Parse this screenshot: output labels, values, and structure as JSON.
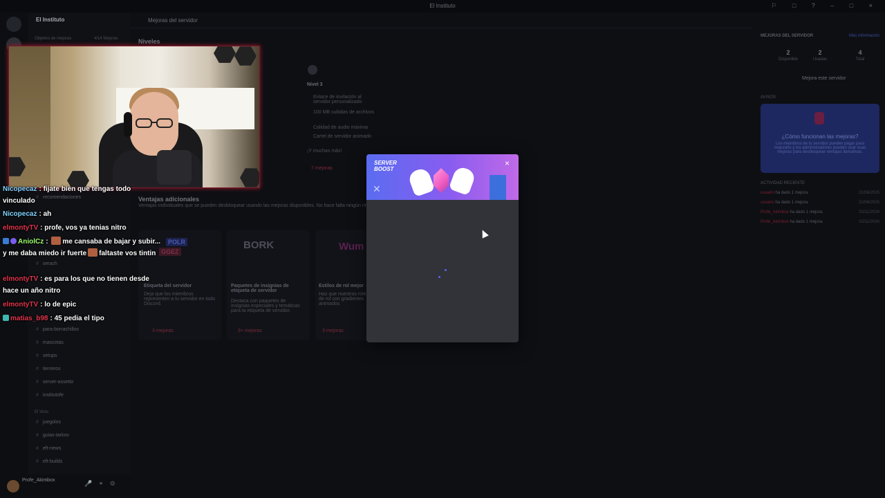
{
  "window": {
    "title": "El Instituto"
  },
  "sidebar": {
    "server_name": "El Instituto",
    "boost_goal": "Objetivo de mejoras",
    "boost_progress": "4/14 Mejoras",
    "channels": [
      "recomendaciones",
      "serach",
      "para-borrachillos",
      "mascotas",
      "setups",
      "tierreros",
      "server-assetto",
      "institutofe"
    ],
    "category": "El Vicio",
    "game_channels": [
      "juegolos",
      "guias-tarkov",
      "eft-news",
      "eft-builds"
    ],
    "user": {
      "name": "Profe_Akimbox"
    }
  },
  "main": {
    "header_title": "Mejoras del servidor",
    "levels_heading": "Niveles",
    "level3": {
      "title": "Nivel 3",
      "perks": [
        "Enlace de invitación al servidor personalizado",
        "100 MB subidas de archivos",
        "Calidad de audio máxima",
        "Cartel de servidor animado"
      ],
      "more": "¡Y muchas más!",
      "req": "7 mejoras"
    },
    "extras_heading": "Ventajas adicionales",
    "extras_sub": "Ventajas individuales que se pueden desbloquear usando las mejoras disponibles. No hace falta ningún nivel.",
    "cards": [
      {
        "title": "Etiqueta del servidor",
        "desc": "Deja que los miembros representen a tu servidor en todo Discord.",
        "req": "3 mejoras"
      },
      {
        "title": "Paquetes de insignias de etiqueta de servidor",
        "desc": "Destaca con paquetes de insignias especiales y temáticas para la etiqueta de servidor.",
        "req": "3+ mejoras"
      },
      {
        "title": "Estilos de rol mejor",
        "desc": "Haz que nuestros roles de rol con gradientes animados",
        "req": "3 mejoras"
      }
    ],
    "tag_badges": [
      "POLR",
      "GGEZ"
    ],
    "bork_label": "BORK",
    "wump_label": "Wum"
  },
  "right_panel": {
    "heading": "MEJORAS DEL SERVIDOR",
    "more_info": "Más información",
    "stats": [
      {
        "n": "2",
        "label": "Disponible"
      },
      {
        "n": "2",
        "label": "Usadas"
      },
      {
        "n": "4",
        "label": "Total"
      }
    ],
    "boost_button": "Mejora este servidor",
    "help_heading": "AVISOS",
    "promo_title": "¿Cómo funcionan las mejoras?",
    "promo_text": "Los miembros de tu servidor pueden pagar para mejorarlo y los administradores pueden usar esas mejoras para desbloquear ventajas llamativas.",
    "activity_heading": "ACTIVIDAD RECIENTE",
    "activity": [
      {
        "who": "usuario",
        "text": "ha dado 1 mejora.",
        "date": "21/06/2025"
      },
      {
        "who": "usuario",
        "text": "ha dado 1 mejora.",
        "date": "21/06/2025"
      },
      {
        "who": "Profe_Akimbox",
        "text": "ha dado 1 mejora.",
        "date": "02/11/2024"
      },
      {
        "who": "Profe_Akimbox",
        "text": "ha dado 1 mejora.",
        "date": "02/11/2024"
      }
    ]
  },
  "chat": [
    {
      "user": "Nicopecaz",
      "color": "#7fd3ff",
      "text": "fijate bien que tengas todo vinculado"
    },
    {
      "user": "Nicopecaz",
      "color": "#7fd3ff",
      "text": "ah"
    },
    {
      "user": "elmontyTV",
      "color": "#e0344c",
      "text": "profe, vos ya tenias nitro"
    },
    {
      "user": "AniolCz",
      "color": "#9cff6a",
      "text": "me cansaba de bajar y subir... y me daba miedo ir fuerte",
      "text2": "faltaste vos tintin"
    },
    {
      "user": "elmontyTV",
      "color": "#e0344c",
      "text": "es para los que no tienen desde hace un año nitro"
    },
    {
      "user": "elmontyTV",
      "color": "#e0344c",
      "text": "lo de epic"
    },
    {
      "user": "matias_b98",
      "color": "#e0344c",
      "text": "45 pedia el tipo"
    }
  ],
  "modal": {
    "logo_line1": "SERVER",
    "logo_line2": "BOOST",
    "close_glyph": "×"
  }
}
